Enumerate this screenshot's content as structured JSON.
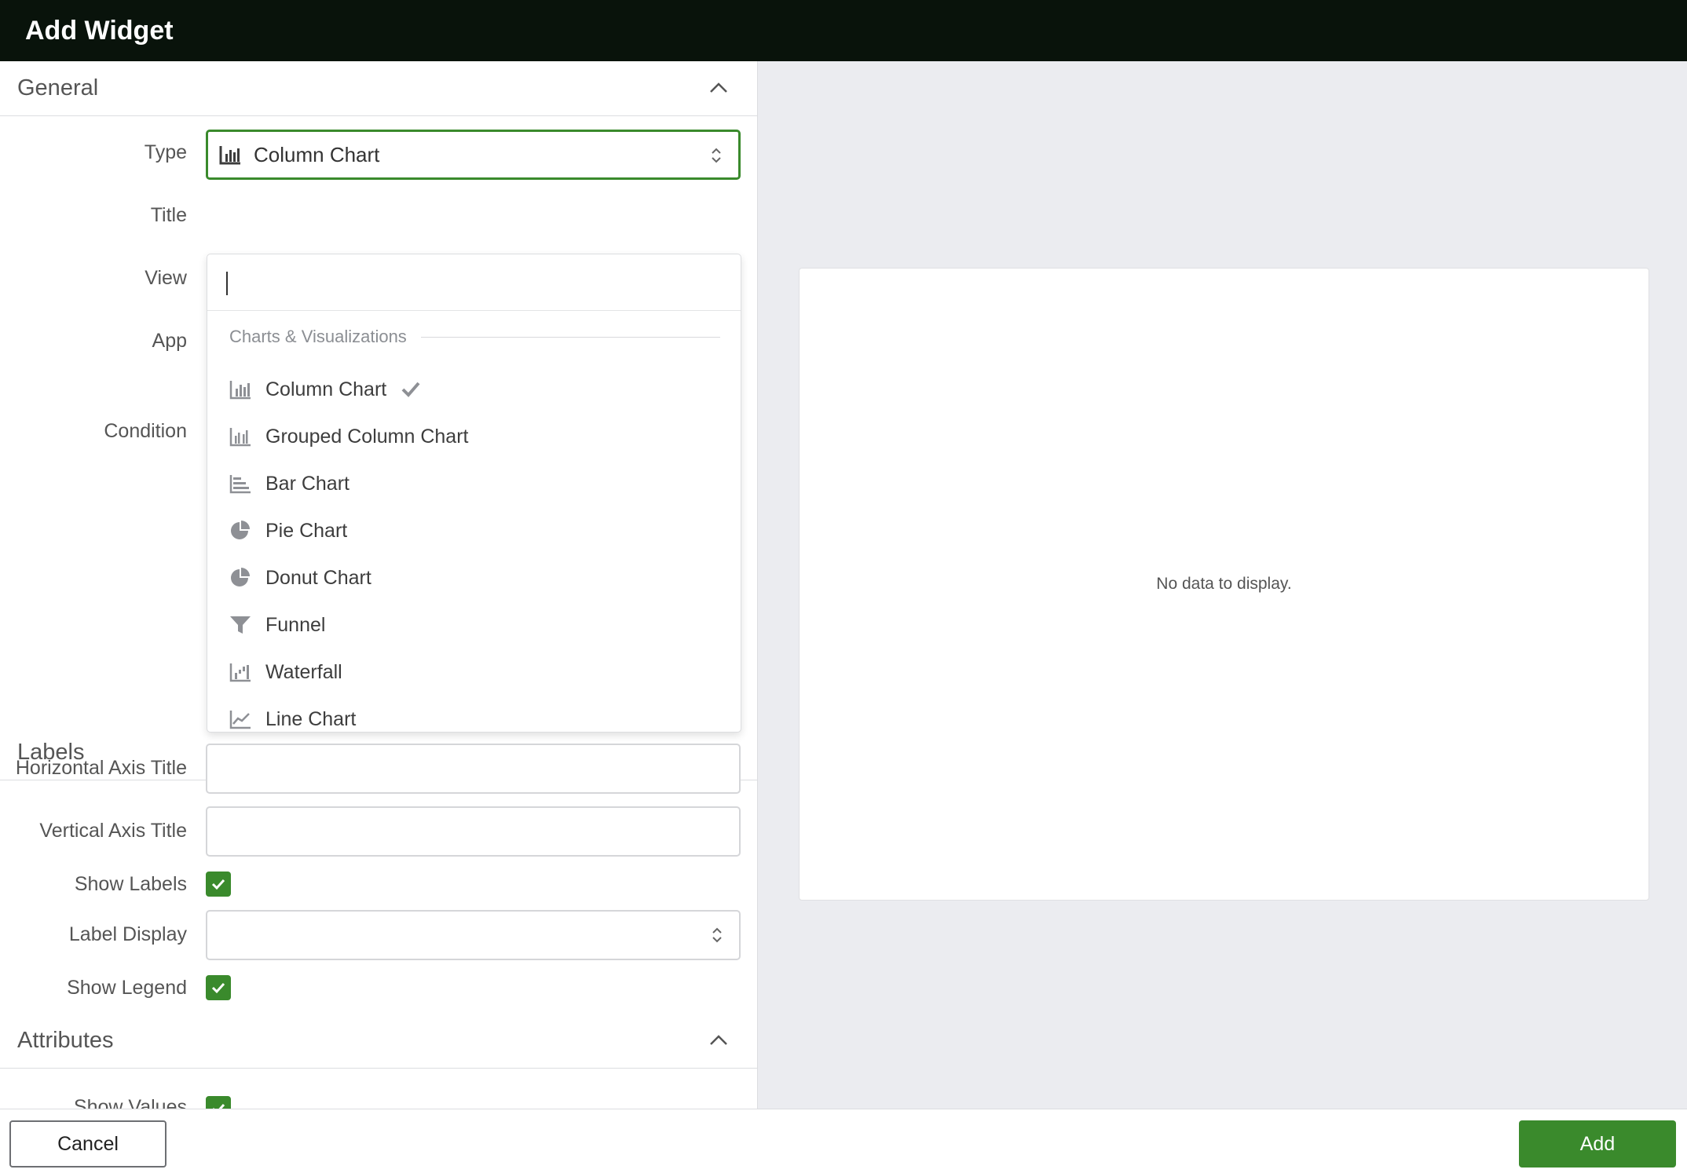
{
  "window": {
    "title": "Add Widget"
  },
  "general": {
    "header": "General",
    "labels": {
      "type": "Type",
      "title": "Title",
      "view": "View",
      "app": "App",
      "condition": "Condition"
    },
    "type_value": "Column Chart"
  },
  "dropdown": {
    "search_value": "",
    "group_label": "Charts & Visualizations",
    "items": [
      {
        "label": "Column Chart",
        "icon": "column-chart-icon",
        "selected": true
      },
      {
        "label": "Grouped Column Chart",
        "icon": "grouped-column-chart-icon",
        "selected": false
      },
      {
        "label": "Bar Chart",
        "icon": "bar-chart-icon",
        "selected": false
      },
      {
        "label": "Pie Chart",
        "icon": "pie-chart-icon",
        "selected": false
      },
      {
        "label": "Donut Chart",
        "icon": "donut-chart-icon",
        "selected": false
      },
      {
        "label": "Funnel",
        "icon": "funnel-icon",
        "selected": false
      },
      {
        "label": "Waterfall",
        "icon": "waterfall-icon",
        "selected": false
      },
      {
        "label": "Line Chart",
        "icon": "line-chart-icon",
        "selected": false
      }
    ]
  },
  "labels_section": {
    "header": "Labels",
    "horizontal_axis_title": "Horizontal Axis Title",
    "vertical_axis_title": "Vertical Axis Title",
    "show_labels": "Show Labels",
    "show_labels_checked": true,
    "label_display": "Label Display",
    "show_legend": "Show Legend",
    "show_legend_checked": true
  },
  "attributes_section": {
    "header": "Attributes",
    "show_values": "Show Values",
    "show_values_checked": true
  },
  "preview": {
    "empty_text": "No data to display."
  },
  "footer": {
    "cancel_label": "Cancel",
    "add_label": "Add"
  },
  "colors": {
    "accent": "#3a8a2c",
    "titlebar": "#09130b",
    "preview_bg": "#ebecf0"
  }
}
